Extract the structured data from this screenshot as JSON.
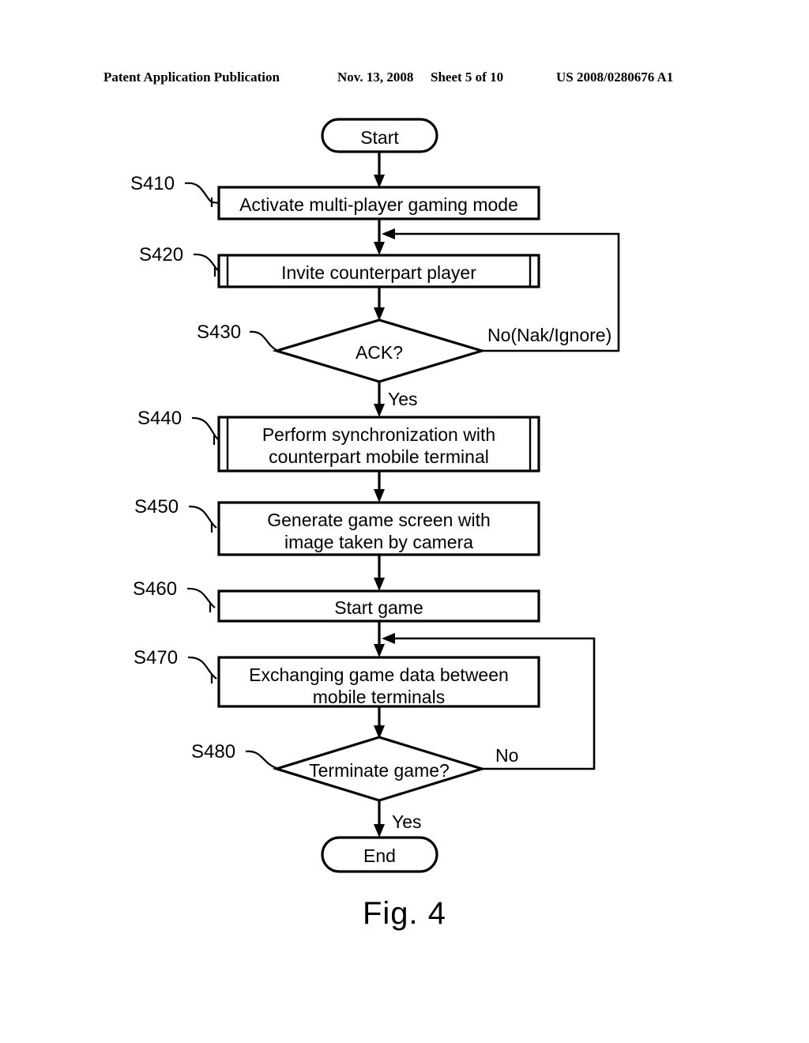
{
  "header": {
    "publication": "Patent Application Publication",
    "date": "Nov. 13, 2008",
    "sheet": "Sheet 5 of 10",
    "patent_number": "US 2008/0280676 A1"
  },
  "figure": {
    "caption": "Fig. 4"
  },
  "chart_data": {
    "type": "diagram",
    "title": "Fig. 4",
    "diagram_kind": "flowchart",
    "nodes": [
      {
        "id": "start",
        "ref": "",
        "shape": "terminator",
        "text": "Start"
      },
      {
        "id": "s410",
        "ref": "S410",
        "shape": "process",
        "text": "Activate multi-player gaming mode"
      },
      {
        "id": "s420",
        "ref": "S420",
        "shape": "predefined-process",
        "text": "Invite counterpart player"
      },
      {
        "id": "s430",
        "ref": "S430",
        "shape": "decision",
        "text": "ACK?"
      },
      {
        "id": "s440",
        "ref": "S440",
        "shape": "predefined-process",
        "text": "Perform synchronization with\ncounterpart mobile terminal"
      },
      {
        "id": "s450",
        "ref": "S450",
        "shape": "process",
        "text": "Generate game screen with\nimage taken by camera"
      },
      {
        "id": "s460",
        "ref": "S460",
        "shape": "process",
        "text": "Start game"
      },
      {
        "id": "s470",
        "ref": "S470",
        "shape": "process",
        "text": "Exchanging game data between\nmobile terminals"
      },
      {
        "id": "s480",
        "ref": "S480",
        "shape": "decision",
        "text": "Terminate game?"
      },
      {
        "id": "end",
        "ref": "",
        "shape": "terminator",
        "text": "End"
      }
    ],
    "edges": [
      {
        "from": "start",
        "to": "s410",
        "label": ""
      },
      {
        "from": "s410",
        "to": "s420",
        "label": ""
      },
      {
        "from": "s420",
        "to": "s430",
        "label": ""
      },
      {
        "from": "s430",
        "to": "s440",
        "label": "Yes"
      },
      {
        "from": "s430",
        "to": "s420",
        "label": "No(Nak/Ignore)"
      },
      {
        "from": "s440",
        "to": "s450",
        "label": ""
      },
      {
        "from": "s450",
        "to": "s460",
        "label": ""
      },
      {
        "from": "s460",
        "to": "s470",
        "label": ""
      },
      {
        "from": "s470",
        "to": "s480",
        "label": ""
      },
      {
        "from": "s480",
        "to": "end",
        "label": "Yes"
      },
      {
        "from": "s480",
        "to": "s470",
        "label": "No"
      }
    ]
  },
  "nodes": {
    "start": {
      "text": "Start"
    },
    "s410": {
      "ref": "S410",
      "text": "Activate multi-player gaming mode"
    },
    "s420": {
      "ref": "S420",
      "text": "Invite counterpart player"
    },
    "s430": {
      "ref": "S430",
      "text": "ACK?"
    },
    "s440": {
      "ref": "S440",
      "text": "Perform synchronization with\ncounterpart mobile terminal"
    },
    "s450": {
      "ref": "S450",
      "text": "Generate game screen with\nimage taken by camera"
    },
    "s460": {
      "ref": "S460",
      "text": "Start game"
    },
    "s470": {
      "ref": "S470",
      "text": "Exchanging game data between\nmobile terminals"
    },
    "s480": {
      "ref": "S480",
      "text": "Terminate game?"
    },
    "end": {
      "text": "End"
    }
  },
  "edge_labels": {
    "ack_no": "No(Nak/Ignore)",
    "ack_yes": "Yes",
    "terminate_no": "No",
    "terminate_yes": "Yes"
  },
  "colors": {
    "ink": "#000000",
    "paper": "#ffffff"
  }
}
